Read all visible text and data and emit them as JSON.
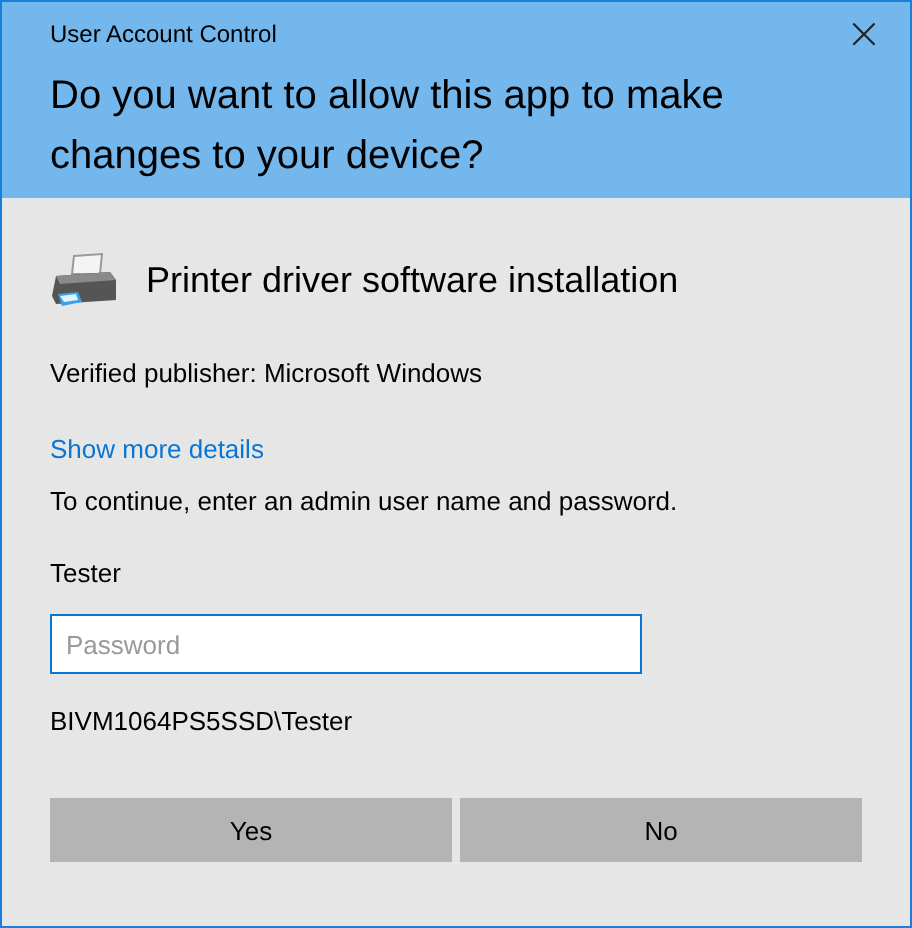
{
  "window": {
    "title": "User Account Control",
    "close": "×"
  },
  "question": "Do you want to allow this app to make changes to your device?",
  "app": {
    "name": "Printer driver software installation"
  },
  "publisher": "Verified publisher: Microsoft Windows",
  "details_link": "Show more details",
  "instruction": "To continue, enter an admin user name and password.",
  "username": "Tester",
  "password": {
    "placeholder": "Password"
  },
  "domain_user": "BIVM1064PS5SSD\\Tester",
  "buttons": [
    "Yes",
    "No"
  ]
}
